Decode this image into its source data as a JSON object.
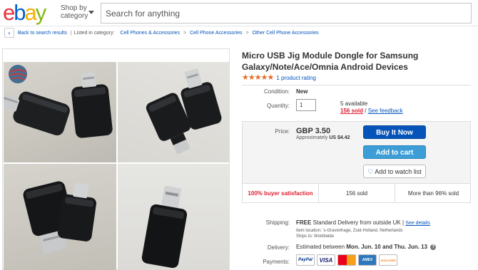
{
  "header": {
    "logo_letters": [
      {
        "ch": "e",
        "color": "#e53238"
      },
      {
        "ch": "b",
        "color": "#0064d2"
      },
      {
        "ch": "a",
        "color": "#f5af02"
      },
      {
        "ch": "y",
        "color": "#86b817"
      }
    ],
    "shop_by_line1": "Shop by",
    "shop_by_line2": "category",
    "search_placeholder": "Search for anything"
  },
  "breadcrumb": {
    "back_label": "Back to search results",
    "listed_label": "Listed in category:",
    "crumbs": [
      "Cell Phones & Accessories",
      "Cell Phone Accessories",
      "Other Cell Phone Accessories"
    ]
  },
  "product": {
    "title": "Micro USB Jig Module Dongle for Samsung Galaxy/Note/Ace/Omnia Android Devices",
    "stars": "★★★★★",
    "rating_count": "1 product rating",
    "condition_label": "Condition:",
    "condition_value": "New",
    "quantity_label": "Quantity:",
    "quantity_value": "1",
    "available": "5 available",
    "sold_link": "156 sold",
    "sold_sep": " / ",
    "feedback_link": "See feedback",
    "price_label": "Price:",
    "price": "GBP 3.50",
    "approx_label": "Approximately",
    "approx_value": "US $4.42",
    "buy_now": "Buy It Now",
    "add_to_cart": "Add to cart",
    "watch": "Add to watch list",
    "stat_satisfaction": "100% buyer satisfaction",
    "stat_sold": "156 sold",
    "stat_more": "More than 96% sold",
    "shipping_label": "Shipping:",
    "shipping_free": "FREE",
    "shipping_text": "Standard Delivery from outside UK",
    "shipping_sep": " | ",
    "see_details": "See details",
    "item_location": "Item location:  's-Gravenhage, Zuid-Holland, Netherlands",
    "ships_to": "Ships to:  Worldwide",
    "delivery_label": "Delivery:",
    "delivery_prefix": "Estimated between ",
    "delivery_dates": "Mon. Jun. 10 and Thu. Jun. 13",
    "payments_label": "Payments:",
    "payment_methods": [
      "PayPal",
      "VISA",
      "MC",
      "AMEX",
      "DISCOVER"
    ]
  },
  "colors": {
    "link": "#0654ba",
    "buy_button": "#0654ba",
    "cart_button": "#3d9dd6",
    "sold_red": "#dd1e31",
    "star_orange": "#e96b29"
  }
}
